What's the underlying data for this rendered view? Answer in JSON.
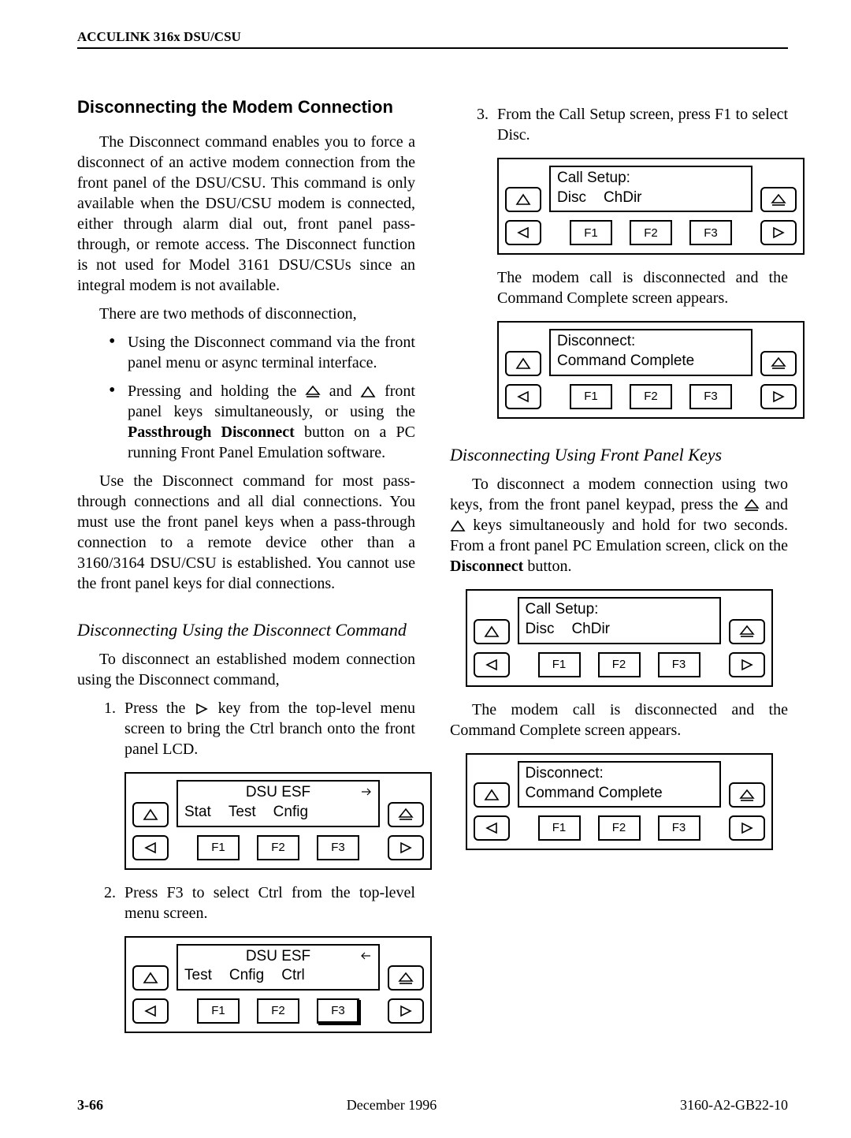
{
  "header": {
    "running": "ACCULINK 316x DSU/CSU"
  },
  "section": {
    "title": "Disconnecting the Modem Connection"
  },
  "intro": {
    "p1": "The Disconnect command enables you to force a disconnect of an active modem connection from the front panel of the DSU/CSU. This command is only available when the DSU/CSU modem is connected, either through alarm dial out, front panel pass-through, or remote access. The Disconnect function is not used for Model 3161 DSU/CSUs since an integral modem is not available.",
    "p2": "There are two methods of disconnection,",
    "bul1": "Using the Disconnect command via the front panel menu or async terminal interface.",
    "bul2a": "Pressing and holding the ",
    "bul2b": " and ",
    "bul2c": " front panel keys simultaneously, or using the ",
    "bul2d": "Passthrough Disconnect",
    "bul2e": " button on a PC running Front Panel Emulation software.",
    "p3": "Use the Disconnect command for most pass-through connections and all dial connections. You must use the front panel keys when a pass-through connection to a remote device other than a 3160/3164 DSU/CSU is established. You cannot use the front panel keys for dial connections."
  },
  "sub1": {
    "title": "Disconnecting Using the Disconnect Command",
    "lead": "To disconnect an established modem connection using the Disconnect command,",
    "step1a": "Press the ",
    "step1b": " key from the top-level menu screen to bring the Ctrl branch onto the front panel LCD.",
    "step2": "Press F3 to select Ctrl from the top-level menu screen.",
    "step3": "From the Call Setup screen, press F1 to select Disc.",
    "after3": "The modem call is disconnected and the Command Complete screen appears."
  },
  "sub2": {
    "title": "Disconnecting Using Front Panel Keys",
    "p1a": "To disconnect a modem connection using two keys, from the front panel keypad, press the ",
    "p1b": " and ",
    "p1c": " keys simultaneously and hold for two seconds. From a front panel PC Emulation screen, click on the ",
    "p1d": "Disconnect",
    "p1e": " button.",
    "p2": "The modem call is disconnected and the Command Complete screen appears."
  },
  "lcd": {
    "dsu_esf": "DSU ESF",
    "stat": "Stat",
    "test": "Test",
    "cnfig": "Cnfig",
    "ctrl": "Ctrl",
    "callsetup": "Call Setup:",
    "disc": "Disc",
    "chdir": "ChDir",
    "disconnect": "Disconnect:",
    "cmdcomplete": "Command Complete",
    "f1": "F1",
    "f2": "F2",
    "f3": "F3"
  },
  "footer": {
    "page": "3-66",
    "date": "December 1996",
    "doc": "3160-A2-GB22-10"
  }
}
